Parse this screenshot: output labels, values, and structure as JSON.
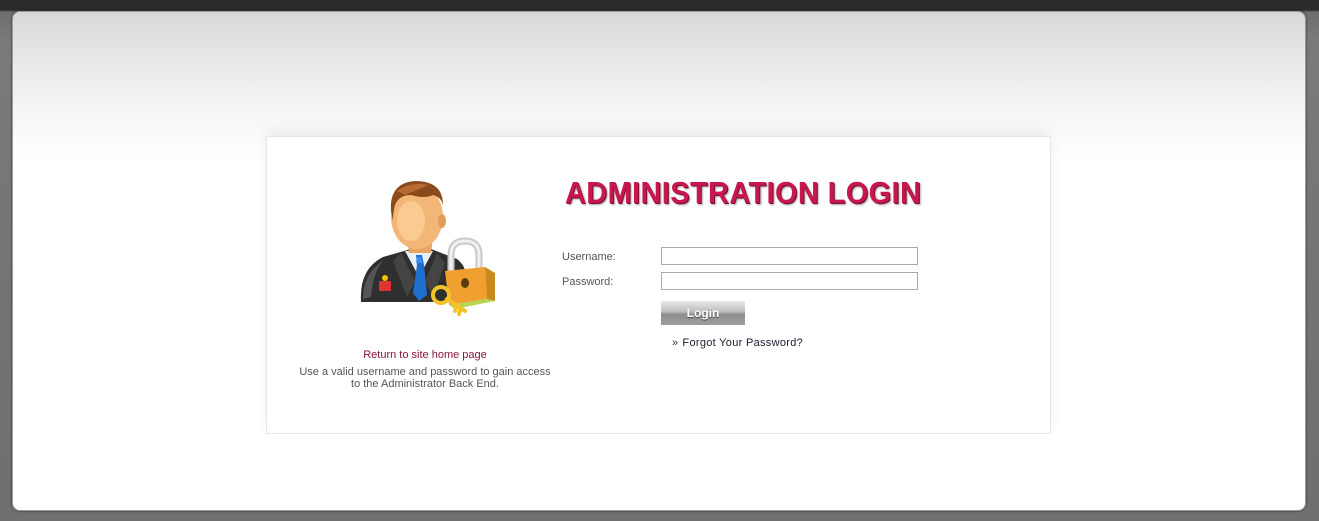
{
  "login": {
    "title": "ADMINISTRATION LOGIN",
    "username_label": "Username:",
    "username_value": "",
    "password_label": "Password:",
    "password_value": "",
    "login_button": "Login",
    "forgot_prefix": "»",
    "forgot_link": "Forgot Your Password?"
  },
  "sidebar": {
    "home_link": "Return to site home page",
    "info_line1": "Use a valid username and password to gain access",
    "info_line2": "to the Administrator Back End."
  },
  "icons": {
    "avatar": "admin-user-with-lock-icon"
  },
  "colors": {
    "title": "#c8174e",
    "home_link": "#8a1538"
  }
}
